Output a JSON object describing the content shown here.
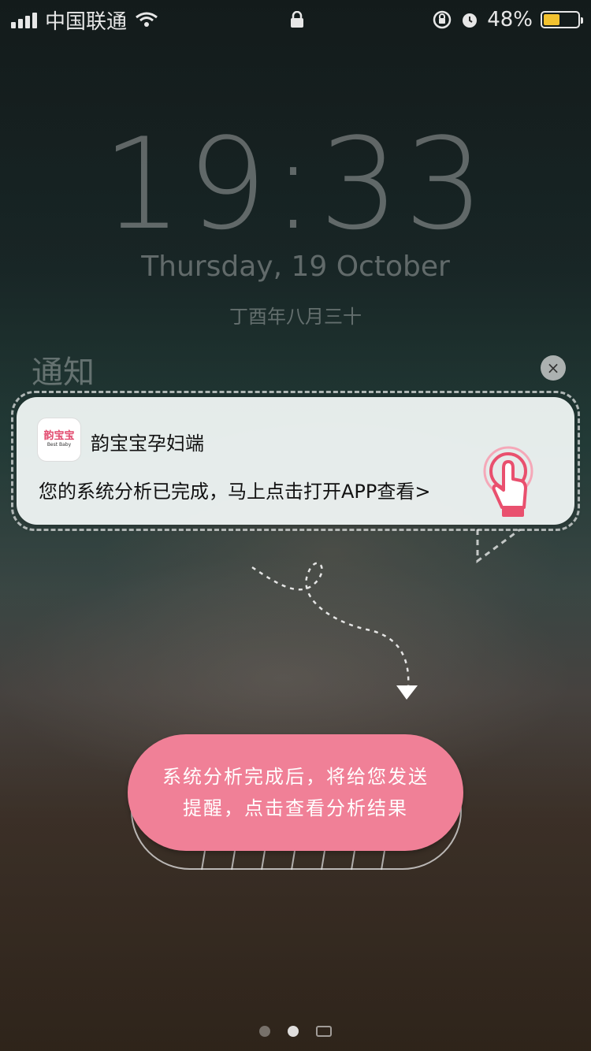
{
  "status_bar": {
    "carrier": "中国联通",
    "battery_percent": "48%",
    "battery_level": 0.48
  },
  "lock_screen": {
    "time": "19:33",
    "date": "Thursday, 19 October",
    "lunar_date": "丁酉年八月三十",
    "notifications_heading": "通知",
    "clear_icon": "×"
  },
  "notification": {
    "app_icon_text": "韵宝宝",
    "app_icon_subtext": "Best Baby",
    "app_name": "韵宝宝孕妇端",
    "body": "您的系统分析已完成，马上点击打开APP查看>"
  },
  "hint": {
    "line1": "系统分析完成后，将给您发送",
    "line2": "提醒，点击查看分析结果",
    "color": "#f08097"
  },
  "icons": [
    "signal-icon",
    "wifi-icon",
    "lock-icon",
    "rotation-lock-icon",
    "alarm-icon",
    "battery-icon",
    "tap-hand-icon",
    "camera-icon"
  ]
}
